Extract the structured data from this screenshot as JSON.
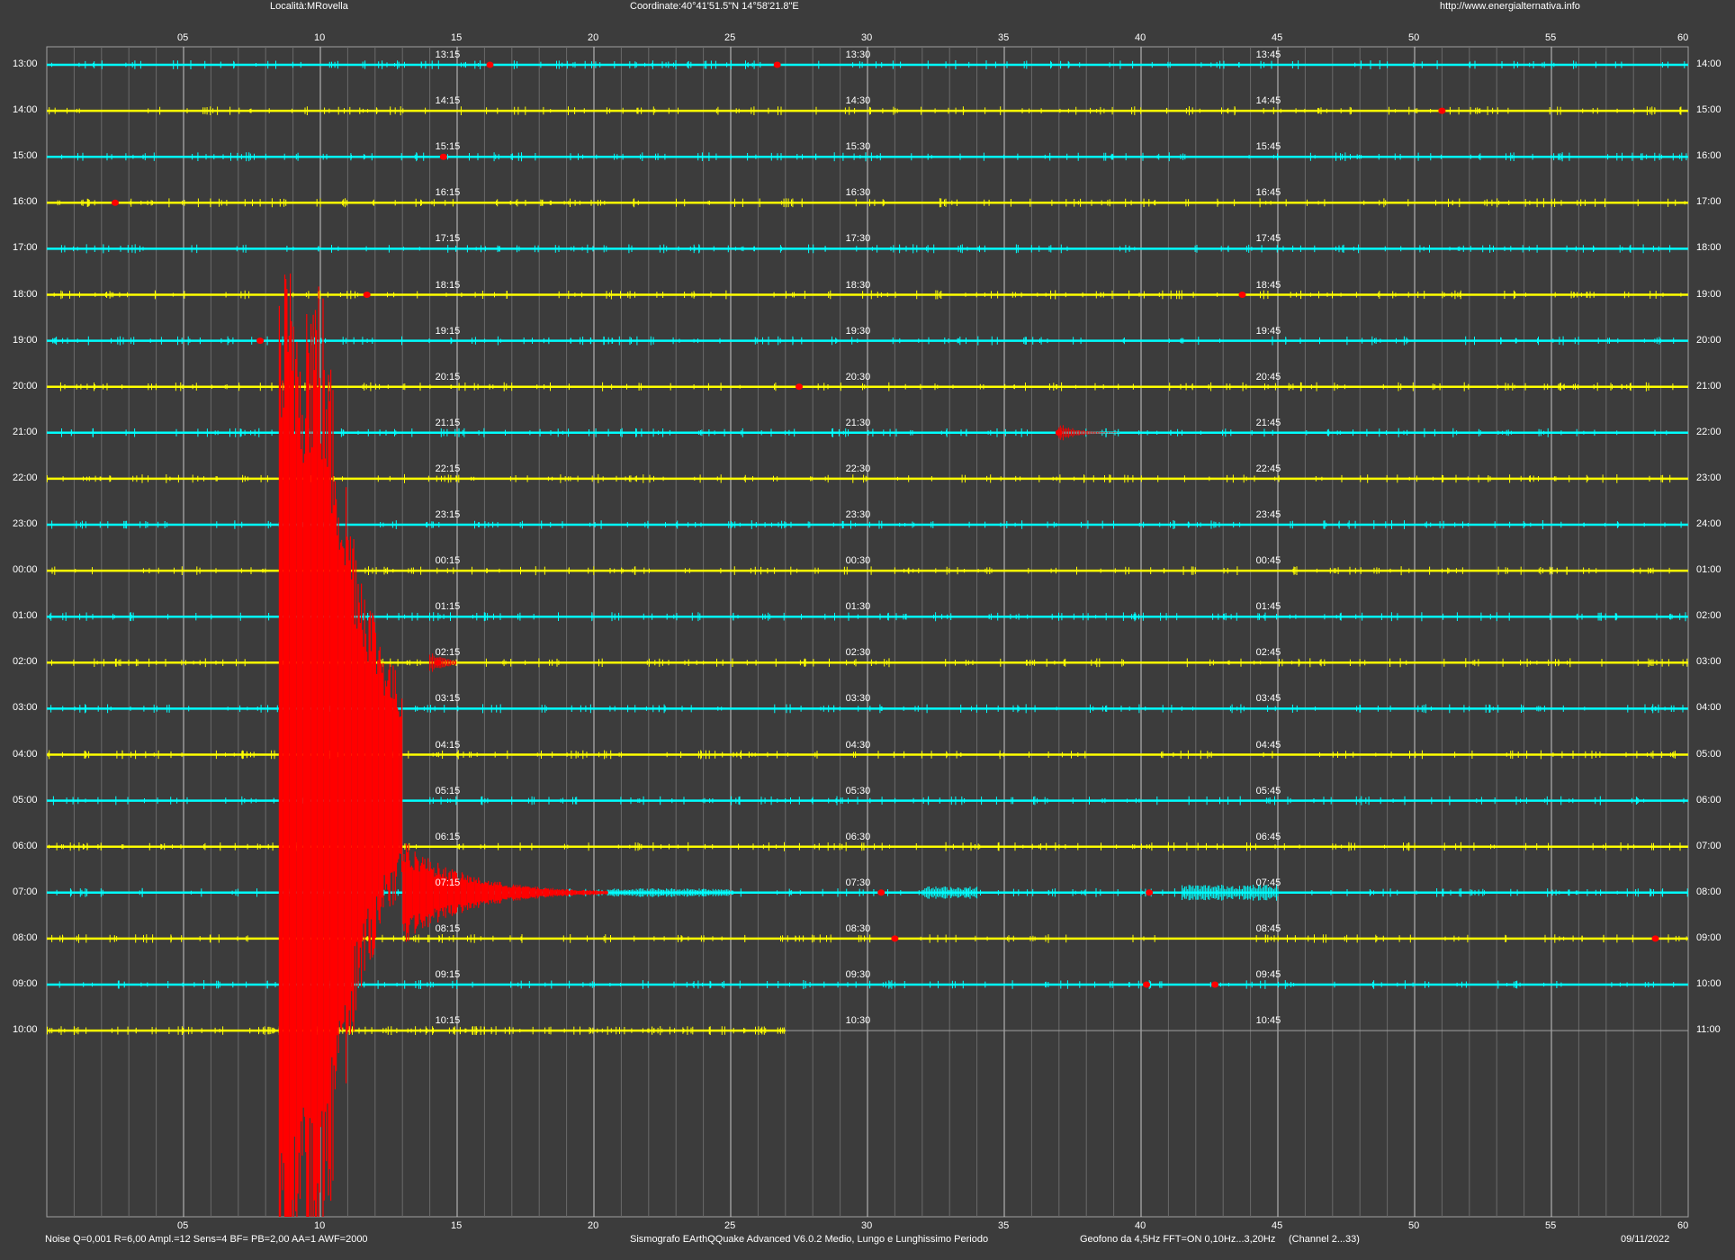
{
  "header": {
    "location": "Località:MRovella",
    "coordinates": "Coordinate:40°41'51.5\"N 14°58'21.8\"E",
    "url": "http://www.energialternativa.info"
  },
  "footer": {
    "settings": "Noise Q=0,001 R=6,00 Ampl.=12 Sens=4 BF= PB=2,00 AA=1 AWF=2000",
    "software": "Sismografo  EArthQQuake Advanced V6.0.2  Medio, Lungo e Lunghissimo Periodo",
    "sensor": "Geofono da 4,5Hz FFT=ON 0,10Hz...3,20Hz",
    "channel": "(Channel 2...33)",
    "date": "09/11/2022"
  },
  "x_axis": {
    "ticks": [
      "05",
      "10",
      "15",
      "20",
      "25",
      "30",
      "35",
      "40",
      "45",
      "50",
      "55",
      "60"
    ]
  },
  "rows": [
    {
      "left": "13:00",
      "right": "14:00",
      "m15": "13:15",
      "m30": "13:30",
      "m45": "13:45",
      "color": "cyan"
    },
    {
      "left": "14:00",
      "right": "15:00",
      "m15": "14:15",
      "m30": "14:30",
      "m45": "14:45",
      "color": "yellow"
    },
    {
      "left": "15:00",
      "right": "16:00",
      "m15": "15:15",
      "m30": "15:30",
      "m45": "15:45",
      "color": "cyan"
    },
    {
      "left": "16:00",
      "right": "17:00",
      "m15": "16:15",
      "m30": "16:30",
      "m45": "16:45",
      "color": "yellow"
    },
    {
      "left": "17:00",
      "right": "18:00",
      "m15": "17:15",
      "m30": "17:30",
      "m45": "17:45",
      "color": "cyan"
    },
    {
      "left": "18:00",
      "right": "19:00",
      "m15": "18:15",
      "m30": "18:30",
      "m45": "18:45",
      "color": "yellow"
    },
    {
      "left": "19:00",
      "right": "20:00",
      "m15": "19:15",
      "m30": "19:30",
      "m45": "19:45",
      "color": "cyan"
    },
    {
      "left": "20:00",
      "right": "21:00",
      "m15": "20:15",
      "m30": "20:30",
      "m45": "20:45",
      "color": "yellow"
    },
    {
      "left": "21:00",
      "right": "22:00",
      "m15": "21:15",
      "m30": "21:30",
      "m45": "21:45",
      "color": "cyan"
    },
    {
      "left": "22:00",
      "right": "23:00",
      "m15": "22:15",
      "m30": "22:30",
      "m45": "22:45",
      "color": "yellow"
    },
    {
      "left": "23:00",
      "right": "24:00",
      "m15": "23:15",
      "m30": "23:30",
      "m45": "23:45",
      "color": "cyan"
    },
    {
      "left": "00:00",
      "right": "01:00",
      "m15": "00:15",
      "m30": "00:30",
      "m45": "00:45",
      "color": "yellow"
    },
    {
      "left": "01:00",
      "right": "02:00",
      "m15": "01:15",
      "m30": "01:30",
      "m45": "01:45",
      "color": "cyan"
    },
    {
      "left": "02:00",
      "right": "03:00",
      "m15": "02:15",
      "m30": "02:30",
      "m45": "02:45",
      "color": "yellow"
    },
    {
      "left": "03:00",
      "right": "04:00",
      "m15": "03:15",
      "m30": "03:30",
      "m45": "03:45",
      "color": "cyan"
    },
    {
      "left": "04:00",
      "right": "05:00",
      "m15": "04:15",
      "m30": "04:30",
      "m45": "04:45",
      "color": "yellow"
    },
    {
      "left": "05:00",
      "right": "06:00",
      "m15": "05:15",
      "m30": "05:30",
      "m45": "05:45",
      "color": "cyan"
    },
    {
      "left": "06:00",
      "right": "07:00",
      "m15": "06:15",
      "m30": "06:30",
      "m45": "06:45",
      "color": "yellow"
    },
    {
      "left": "07:00",
      "right": "08:00",
      "m15": "07:15",
      "m30": "07:30",
      "m45": "07:45",
      "color": "cyan"
    },
    {
      "left": "08:00",
      "right": "09:00",
      "m15": "08:15",
      "m30": "08:30",
      "m45": "08:45",
      "color": "yellow"
    },
    {
      "left": "09:00",
      "right": "10:00",
      "m15": "09:15",
      "m30": "09:30",
      "m45": "09:45",
      "color": "cyan"
    },
    {
      "left": "10:00",
      "right": "11:00",
      "m15": "10:15",
      "m30": "10:30",
      "m45": "10:45",
      "color": "yellow"
    }
  ],
  "colors": {
    "background": "#3c3c3c",
    "cyan": "#00ffff",
    "yellow": "#ffff00",
    "event": "#ff0000",
    "grid": "#a0a0a0",
    "text": "#ffffff"
  },
  "event": {
    "start_minute": 8.5,
    "start_row": "17:00",
    "peak_minute": 10.0
  }
}
